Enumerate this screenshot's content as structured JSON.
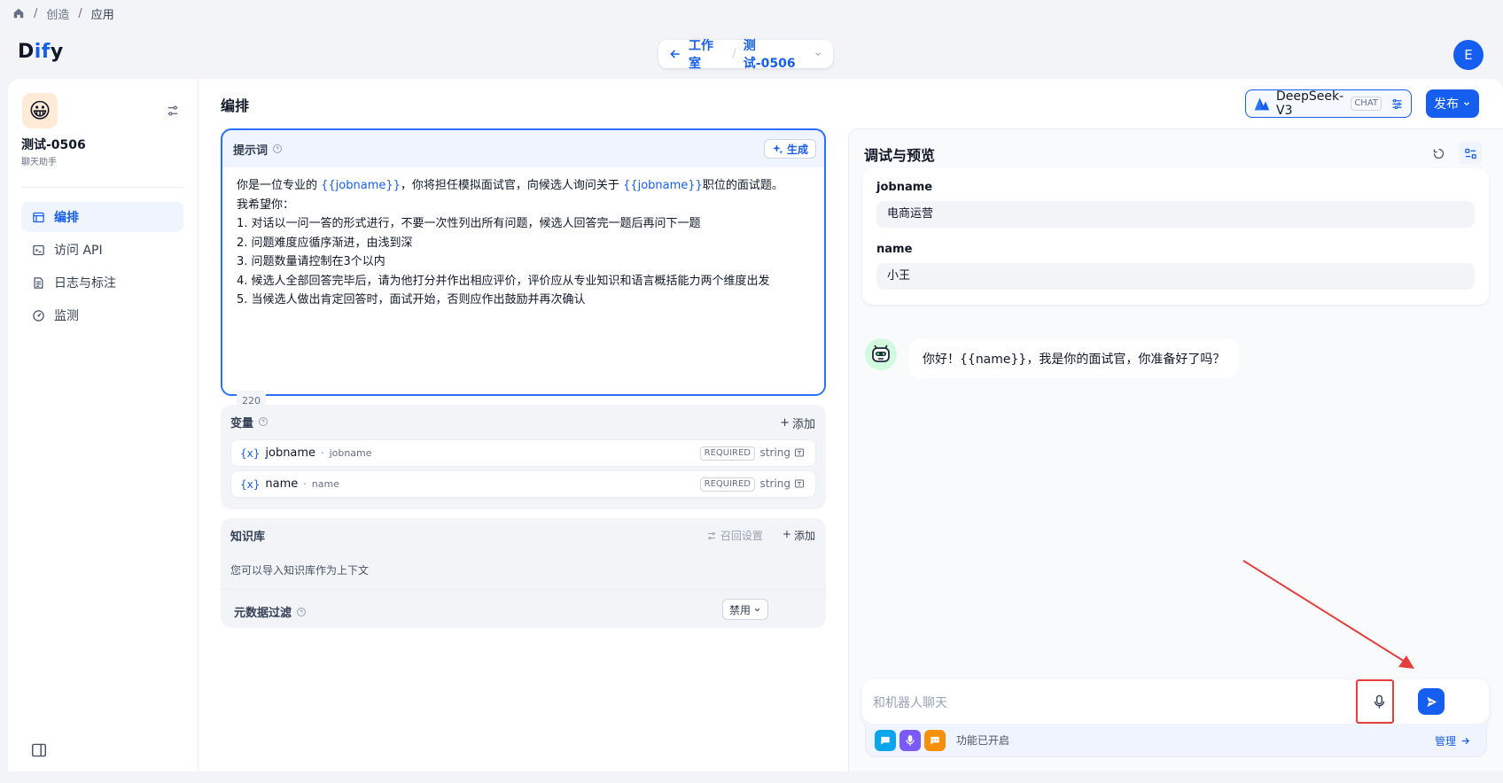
{
  "breadcrumb": {
    "items": [
      "创造",
      "应用"
    ]
  },
  "logo": {
    "prefix": "D",
    "mid": "if",
    "suffix": "y"
  },
  "nav": {
    "back_label": "工作室",
    "app_label": "测试-0506"
  },
  "user": {
    "initial": "E"
  },
  "app": {
    "name": "测试-0506",
    "type": "聊天助手",
    "emoji": "😀"
  },
  "sidebar": {
    "items": [
      {
        "label": "编排",
        "icon": "layout-icon",
        "active": true
      },
      {
        "label": "访问 API",
        "icon": "terminal-icon"
      },
      {
        "label": "日志与标注",
        "icon": "file-list-icon"
      },
      {
        "label": "监测",
        "icon": "dashboard-icon"
      }
    ]
  },
  "main": {
    "title": "编排"
  },
  "model": {
    "name": "DeepSeek-V3",
    "mode": "CHAT"
  },
  "publish": {
    "label": "发布"
  },
  "prompt": {
    "label": "提示词",
    "generate_label": "生成",
    "lines": [
      [
        "你是一位专业的 ",
        "{{jobname}}",
        "，你将担任模拟面试官，向候选人询问关于 ",
        "{{jobname}}",
        "职位的面试题。"
      ],
      "我希望你：",
      "1. 对话以一问一答的形式进行，不要一次性列出所有问题，候选人回答完一题后再问下一题",
      "2. 问题难度应循序渐进，由浅到深",
      "3. 问题数量请控制在3个以内",
      "4. 候选人全部回答完毕后，请为他打分并作出相应评价，评价应从专业知识和语言概括能力两个维度出发",
      "5. 当候选人做出肯定回答时，面试开始，否则应作出鼓励并再次确认"
    ],
    "char_count": "220"
  },
  "variables": {
    "label": "变量",
    "add_label": "添加",
    "items": [
      {
        "key": "jobname",
        "name": "jobname",
        "required": "REQUIRED",
        "type": "string"
      },
      {
        "key": "name",
        "name": "name",
        "required": "REQUIRED",
        "type": "string"
      }
    ]
  },
  "knowledge": {
    "label": "知识库",
    "retrieval_label": "召回设置",
    "add_label": "添加",
    "description": "您可以导入知识库作为上下文",
    "metadata_label": "元数据过滤",
    "metadata_value": "禁用"
  },
  "preview": {
    "title": "调试与预览",
    "inputs": [
      {
        "label": "jobname",
        "value": "电商运营"
      },
      {
        "label": "name",
        "value": "小王"
      }
    ],
    "bot_message": "你好！{{name}}，我是你的面试官，你准备好了吗？",
    "input_placeholder": "和机器人聊天",
    "features_label": "功能已开启",
    "manage_label": "管理"
  },
  "colors": {
    "accent": "#155eef",
    "highlight": "#e53e3e"
  }
}
